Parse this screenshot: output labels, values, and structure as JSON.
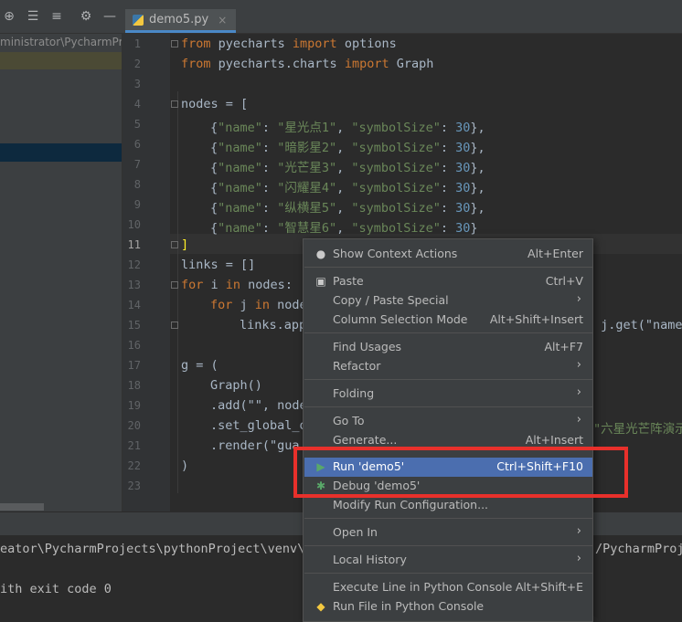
{
  "editor_tab": {
    "filename": "demo5.py",
    "close": "×"
  },
  "project_panel": {
    "path": "ministrator\\PycharmProje"
  },
  "line_numbers": [
    "1",
    "2",
    "3",
    "4",
    "5",
    "6",
    "7",
    "8",
    "9",
    "10",
    "11",
    "12",
    "13",
    "14",
    "15",
    "16",
    "17",
    "18",
    "19",
    "20",
    "21",
    "22",
    "23"
  ],
  "code": {
    "l1": {
      "kw1": "from",
      "mod": " pyecharts ",
      "kw2": "import",
      "rest": " options"
    },
    "l2": {
      "kw1": "from",
      "mod": " pyecharts.charts ",
      "kw2": "import",
      "rest": " Graph"
    },
    "l4": "nodes = [",
    "nodes": [
      {
        "k1": "\"name\"",
        "v1": "\"星光点1\"",
        "k2": "\"symbolSize\"",
        "n": "30",
        "end": "},"
      },
      {
        "k1": "\"name\"",
        "v1": "\"暗影星2\"",
        "k2": "\"symbolSize\"",
        "n": "30",
        "end": "},"
      },
      {
        "k1": "\"name\"",
        "v1": "\"光芒星3\"",
        "k2": "\"symbolSize\"",
        "n": "30",
        "end": "},"
      },
      {
        "k1": "\"name\"",
        "v1": "\"闪耀星4\"",
        "k2": "\"symbolSize\"",
        "n": "30",
        "end": "},"
      },
      {
        "k1": "\"name\"",
        "v1": "\"纵横星5\"",
        "k2": "\"symbolSize\"",
        "n": "30",
        "end": "},"
      },
      {
        "k1": "\"name\"",
        "v1": "\"智慧星6\"",
        "k2": "\"symbolSize\"",
        "n": "30",
        "end": "}"
      }
    ],
    "l11": "]",
    "l12": "links = []",
    "l13": {
      "kw1": "for",
      "a": " i ",
      "kw2": "in",
      "b": " nodes:"
    },
    "l14": {
      "kw1": "for",
      "a": " j ",
      "kw2": "in",
      "b": " node"
    },
    "l15": "links.app",
    "l15_right": " j.get(\"name\"",
    "l17": "g = (",
    "l18": "Graph()",
    "l19": ".add(\"\", node",
    "l20": ".set_global_o",
    "l20_right": "\"六星光芒阵演示",
    "l21": ".render(\"gua",
    "l22": ")"
  },
  "run_output": {
    "line1_left": "eator\\PycharmProjects\\pythonProject\\venv\\S",
    "line1_right": "/PycharmProj",
    "line2": "ith exit code 0"
  },
  "context_menu": {
    "items": [
      {
        "label": "Show Context Actions",
        "shortcut": "Alt+Enter",
        "icon": "lightbulb-icon"
      },
      {
        "label": "Paste",
        "shortcut": "Ctrl+V",
        "icon": "clipboard-icon"
      },
      {
        "label": "Copy / Paste Special",
        "shortcut": "",
        "submenu": true
      },
      {
        "label": "Column Selection Mode",
        "shortcut": "Alt+Shift+Insert"
      },
      {
        "label": "Find Usages",
        "shortcut": "Alt+F7"
      },
      {
        "label": "Refactor",
        "shortcut": "",
        "submenu": true
      },
      {
        "label": "Folding",
        "shortcut": "",
        "submenu": true
      },
      {
        "label": "Go To",
        "shortcut": "",
        "submenu": true
      },
      {
        "label": "Generate...",
        "shortcut": "Alt+Insert"
      },
      {
        "label": "Run 'demo5'",
        "shortcut": "Ctrl+Shift+F10",
        "icon": "run-icon",
        "selected": true
      },
      {
        "label": "Debug 'demo5'",
        "shortcut": "",
        "icon": "debug-icon"
      },
      {
        "label": "Modify Run Configuration...",
        "shortcut": ""
      },
      {
        "label": "Open In",
        "shortcut": "",
        "submenu": true
      },
      {
        "label": "Local History",
        "shortcut": "",
        "submenu": true
      },
      {
        "label": "Execute Line in Python Console",
        "shortcut": "Alt+Shift+E"
      },
      {
        "label": "Run File in Python Console",
        "shortcut": "",
        "icon": "python-icon"
      }
    ]
  },
  "colors": {
    "keyword": "#cc7832",
    "string": "#6a8759",
    "number": "#6897bb",
    "selection": "#4b6eaf",
    "annotation_box": "#e8302b"
  }
}
